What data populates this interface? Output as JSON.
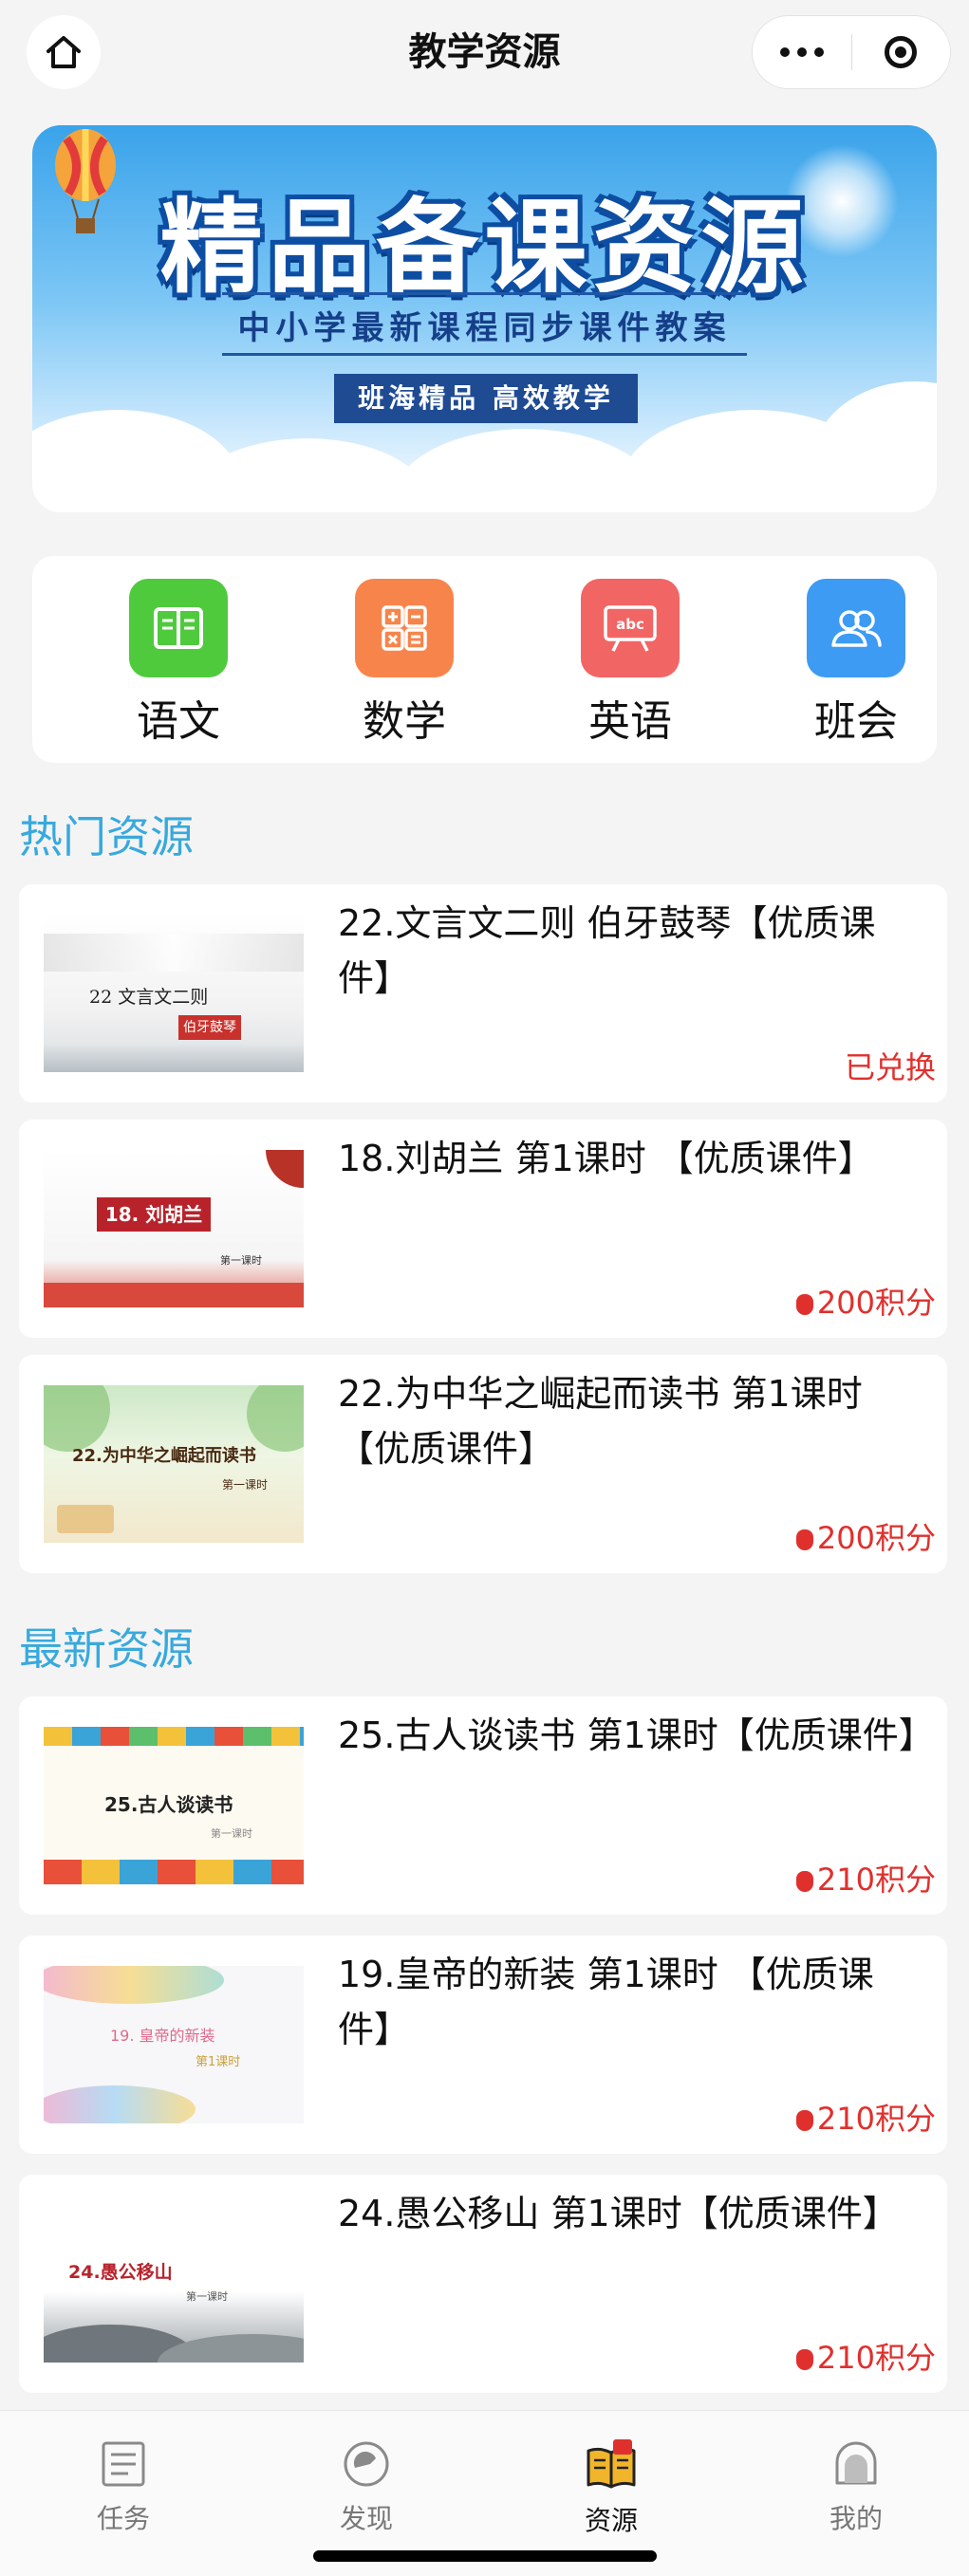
{
  "nav": {
    "title": "教学资源"
  },
  "banner": {
    "title": "精品备课资源",
    "subtitle": "中小学最新课程同步课件教案",
    "tag": "班海精品 高效教学"
  },
  "subjects": [
    {
      "label": "语文",
      "color": "#4fca3d",
      "icon": "book-icon"
    },
    {
      "label": "数学",
      "color": "#f7854b",
      "icon": "calculator-icon"
    },
    {
      "label": "英语",
      "color": "#f26565",
      "icon": "abc-board-icon"
    },
    {
      "label": "班会",
      "color": "#3d9bf4",
      "icon": "group-icon"
    }
  ],
  "hot": {
    "title": "热门资源",
    "items": [
      {
        "title": "22.文言文二则 伯牙鼓琴【优质课件】",
        "price": "已兑换",
        "thumb_text": "22 文言文二则",
        "thumb_sub": "伯牙鼓琴"
      },
      {
        "title": "18.刘胡兰 第1课时 【优质课件】",
        "price": "200积分",
        "thumb_text": "18. 刘胡兰",
        "thumb_sub": "第一课时"
      },
      {
        "title": "22.为中华之崛起而读书 第1课时【优质课件】",
        "price": "200积分",
        "thumb_text": "22.为中华之崛起而读书",
        "thumb_sub": "第一课时"
      }
    ]
  },
  "latest": {
    "title": "最新资源",
    "items": [
      {
        "title": "25.古人谈读书 第1课时【优质课件】",
        "price": "210积分",
        "thumb_text": "25.古人谈读书",
        "thumb_sub": "第一课时"
      },
      {
        "title": "19.皇帝的新装 第1课时 【优质课件】",
        "price": "210积分",
        "thumb_text": "19. 皇帝的新装",
        "thumb_sub": "第1课时"
      },
      {
        "title": "24.愚公移山 第1课时【优质课件】",
        "price": "210积分",
        "thumb_text": "24.愚公移山",
        "thumb_sub": "第一课时"
      }
    ]
  },
  "tabs": [
    {
      "label": "任务",
      "icon": "task-icon"
    },
    {
      "label": "发现",
      "icon": "discover-icon"
    },
    {
      "label": "资源",
      "icon": "resource-icon",
      "active": true
    },
    {
      "label": "我的",
      "icon": "profile-icon"
    }
  ],
  "colors": {
    "accent": "#38a9dd",
    "price": "#e0302d"
  }
}
